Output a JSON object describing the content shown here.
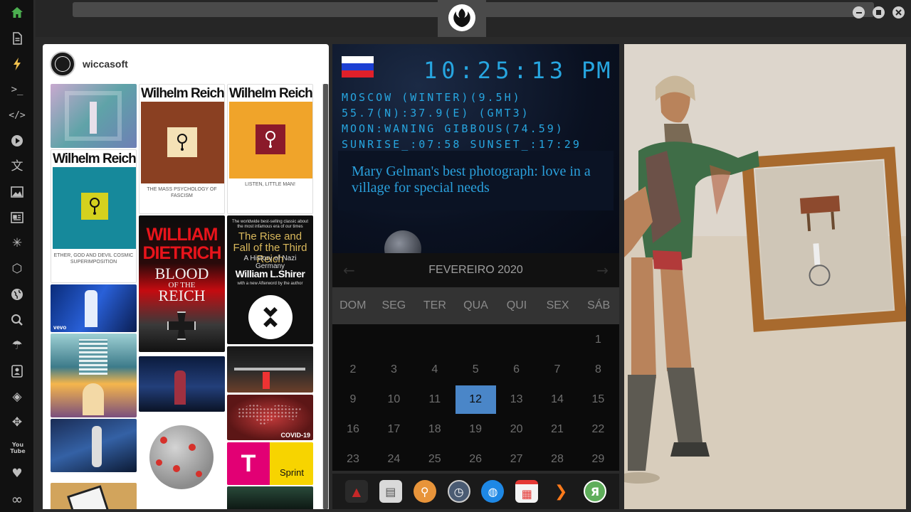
{
  "sidebar": {
    "items": [
      {
        "name": "home-icon",
        "glyph": "⌂"
      },
      {
        "name": "document-icon",
        "glyph": "▤"
      },
      {
        "name": "lightning-icon",
        "glyph": "ϟ"
      },
      {
        "name": "terminal-icon",
        "glyph": ">_"
      },
      {
        "name": "code-icon",
        "glyph": "</>"
      },
      {
        "name": "play-icon",
        "glyph": "▶"
      },
      {
        "name": "translate-icon",
        "glyph": "文"
      },
      {
        "name": "image-icon",
        "glyph": "▣"
      },
      {
        "name": "news-icon",
        "glyph": "▦"
      },
      {
        "name": "asterisk-icon",
        "glyph": "✳"
      },
      {
        "name": "hexagon-icon",
        "glyph": "⬡"
      },
      {
        "name": "globe-icon",
        "glyph": "◍"
      },
      {
        "name": "search-icon",
        "glyph": "⚲"
      },
      {
        "name": "umbrella-icon",
        "glyph": "☂"
      },
      {
        "name": "contact-icon",
        "glyph": "☺"
      },
      {
        "name": "tag-icon",
        "glyph": "◈"
      },
      {
        "name": "expand-icon",
        "glyph": "✥"
      },
      {
        "name": "youtube-icon",
        "glyph": "You Tube"
      },
      {
        "name": "heart-icon",
        "glyph": "♥"
      },
      {
        "name": "infinity-icon",
        "glyph": "∞"
      }
    ]
  },
  "social": {
    "username": "wiccasoft",
    "books": {
      "mass_title": "Wilhelm Reich",
      "mass_sub": "THE MASS PSYCHOLOGY OF FASCISM",
      "listen_title": "Wilhelm Reich",
      "listen_sub": "LISTEN, LITTLE MAN!",
      "ether_title": "Wilhelm Reich",
      "ether_sub": "ETHER, GOD AND DEVIL COSMIC SUPERIMPOSITION",
      "dietrich_line1": "WILLIAM",
      "dietrich_line2": "DIETRICH",
      "dietrich_line3": "BLOOD",
      "dietrich_line4": "OF THE",
      "dietrich_line5": "REICH",
      "shirer_top": "The worldwide best-selling classic about the most infamous era of our times",
      "shirer_title": "The Rise and Fall of the Third Reich",
      "shirer_sub": "A History of Nazi Germany",
      "shirer_author": "William L.Shirer",
      "shirer_after": "with a new Afterword by the author"
    },
    "vevo_label": "vevo",
    "covid_label": "COVID-19",
    "sprint_label": "Sprint",
    "tmobile_label": "T"
  },
  "clock": {
    "time": "10:25:13",
    "ampm": "PM",
    "lines": [
      "MOSCOW (WINTER)(9.5H)",
      "55.7(N):37.9(E) (GMT3)",
      "MOON:WANING GIBBOUS(74.59)",
      "SUNRISE_:07:58 SUNSET_:17:29"
    ],
    "news": "Mary Gelman's best photograph: love in a village for special needs",
    "flag_colors": [
      "#ffffff",
      "#1c3fd3",
      "#e0202a"
    ]
  },
  "calendar": {
    "title": "FEVEREIRO 2020",
    "prev": "←",
    "next": "→",
    "weekdays": [
      "DOM",
      "SEG",
      "TER",
      "QUA",
      "QUI",
      "SEX",
      "SÁB"
    ],
    "days": [
      "1",
      "2",
      "3",
      "4",
      "5",
      "6",
      "7",
      "8",
      "9",
      "10",
      "11",
      "12",
      "13",
      "14",
      "15",
      "16",
      "17",
      "18",
      "19",
      "20",
      "21",
      "22",
      "23",
      "24",
      "25",
      "26",
      "27",
      "28",
      "29"
    ],
    "today": "12",
    "today_color": "#4a86c8"
  },
  "dock": {
    "items": [
      {
        "name": "vivaldi-icon",
        "glyph": "▲",
        "color": "#c62828"
      },
      {
        "name": "reader-icon",
        "glyph": "▤",
        "color": "#d9d9d9"
      },
      {
        "name": "magnifier-icon",
        "glyph": "⚲",
        "color": "#e8943a"
      },
      {
        "name": "clock-icon",
        "glyph": "◷",
        "color": "#4a5b73"
      },
      {
        "name": "globe-icon",
        "glyph": "◍",
        "color": "#1e88e5"
      },
      {
        "name": "calendar-icon",
        "glyph": "▦",
        "color": "#e53935"
      },
      {
        "name": "forward-icon",
        "glyph": "❯",
        "color": "#ff7a1a"
      },
      {
        "name": "yandex-icon",
        "glyph": "Я",
        "color": "#5fae5b"
      }
    ]
  }
}
